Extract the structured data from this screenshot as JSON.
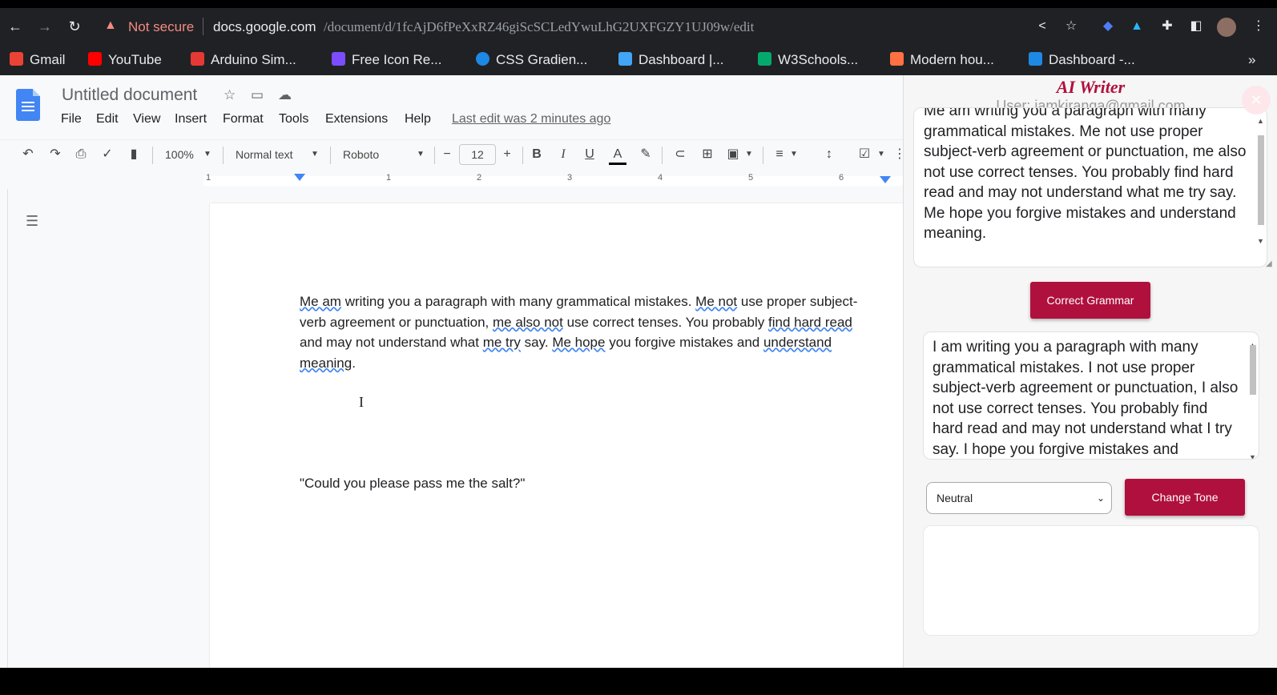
{
  "browser": {
    "security_label": "Not secure",
    "url_host": "docs.google.com",
    "url_path": "/document/d/1fcAjD6fPeXxRZ46giScSCLedYwuLhG2UXFGZY1UJ09w/edit"
  },
  "bookmarks": [
    {
      "label": "Gmail",
      "color": "#ea4335"
    },
    {
      "label": "YouTube",
      "color": "#ff0000"
    },
    {
      "label": "Arduino Sim...",
      "color": "#e53935"
    },
    {
      "label": "Free Icon Re...",
      "color": "#7c4dff"
    },
    {
      "label": "CSS Gradien...",
      "color": "#1e88e5"
    },
    {
      "label": "Dashboard |...",
      "color": "#42a5f5"
    },
    {
      "label": "W3Schools...",
      "color": "#04aa6d"
    },
    {
      "label": "Modern hou...",
      "color": "#ff7043"
    },
    {
      "label": "Dashboard -...",
      "color": "#1e88e5"
    }
  ],
  "docs": {
    "title": "Untitled document",
    "menu": [
      "File",
      "Edit",
      "View",
      "Insert",
      "Format",
      "Tools",
      "Extensions",
      "Help"
    ],
    "last_edit": "Last edit was 2 minutes ago",
    "toolbar": {
      "zoom": "100%",
      "style": "Normal text",
      "font": "Roboto",
      "font_size": "12"
    },
    "ruler_numbers": [
      "1",
      "1",
      "2",
      "3",
      "4",
      "5",
      "6"
    ],
    "paragraph_parts": [
      {
        "t": "Me am",
        "sq": true
      },
      {
        "t": " writing you a paragraph with many grammatical mistakes. ",
        "sq": false
      },
      {
        "t": "Me not",
        "sq": true
      },
      {
        "t": " use proper subject-verb agreement or punctuation, ",
        "sq": false
      },
      {
        "t": "me also not",
        "sq": true
      },
      {
        "t": " use correct tenses. You probably ",
        "sq": false
      },
      {
        "t": "find hard read",
        "sq": true
      },
      {
        "t": " and may not understand what ",
        "sq": false
      },
      {
        "t": "me try",
        "sq": true
      },
      {
        "t": " say. ",
        "sq": false
      },
      {
        "t": "Me hope",
        "sq": true
      },
      {
        "t": " you forgive mistakes and ",
        "sq": false
      },
      {
        "t": "understand meaning",
        "sq": true
      },
      {
        "t": ".",
        "sq": false
      }
    ],
    "quote": "\"Could you please pass me the salt?\""
  },
  "ai_writer": {
    "title": "AI Writer",
    "user": "User: iamkiranga@gmail.com",
    "close_glyph": "✕",
    "input_text": "Me am writing you a paragraph with many grammatical mistakes. Me not use proper subject-verb agreement or punctuation, me also not use correct tenses. You probably find hard read and may not understand what me try say. Me hope you forgive mistakes and understand meaning.",
    "correct_button": "Correct Grammar",
    "output_text": "I am writing you a paragraph with many grammatical mistakes. I not use proper subject-verb agreement or punctuation, I also not use correct tenses. You probably find hard read and may not understand what I try say. I hope you forgive mistakes and understand meaning.",
    "tone_selected": "Neutral",
    "tone_button": "Change Tone",
    "tone_output": ""
  }
}
